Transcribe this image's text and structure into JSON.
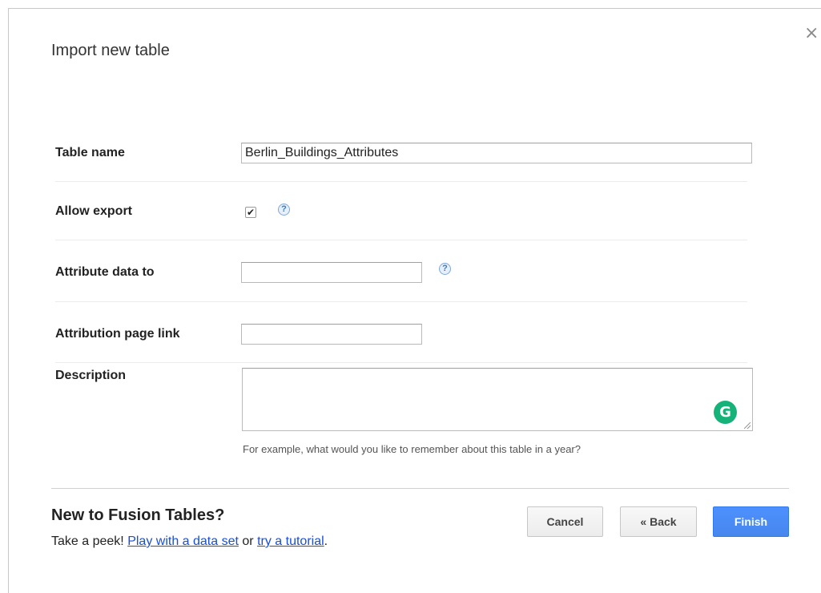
{
  "dialog": {
    "title": "Import new table",
    "close_symbol": "×"
  },
  "form": {
    "table_name": {
      "label": "Table name",
      "value": "Berlin_Buildings_Attributes"
    },
    "allow_export": {
      "label": "Allow export",
      "checked": true,
      "help_symbol": "?"
    },
    "attribute_data_to": {
      "label": "Attribute data to",
      "value": "",
      "help_symbol": "?"
    },
    "attribution_page_link": {
      "label": "Attribution page link",
      "value": ""
    },
    "description": {
      "label": "Description",
      "value": "",
      "hint": "For example, what would you like to remember about this table in a year?"
    },
    "grammarly_icon_letter": "G"
  },
  "promo": {
    "title": "New to Fusion Tables?",
    "prefix": "Take a peek!",
    "link1": "Play with a data set",
    "middle": "or",
    "link2": "try a tutorial",
    "suffix": "."
  },
  "buttons": {
    "cancel": "Cancel",
    "back": "« Back",
    "finish": "Finish"
  },
  "colors": {
    "primary": "#4d90fe",
    "link": "#1a4ed8",
    "grammarly": "#15b27a"
  }
}
